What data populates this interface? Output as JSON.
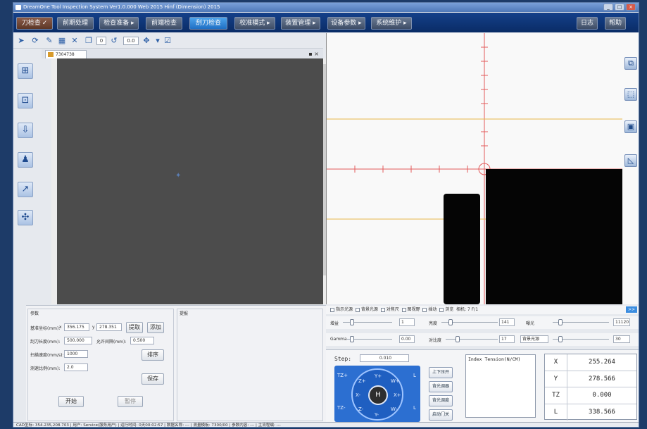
{
  "window": {
    "title": "DreamOne Tool Inspection System Ver1.0.000 Web 2015 Hinf (Dimension) 2015"
  },
  "menu": {
    "first": "刀检查",
    "items": [
      "前期处理",
      "检查准备 ▸",
      "前端检查",
      "刮刀检查",
      "校准模式 ▸",
      "装置管理 ▸",
      "设备参数 ▸",
      "系统维护 ▸"
    ],
    "right": [
      "日志",
      "帮助"
    ]
  },
  "toolbar": {
    "field1": "0",
    "field2": "0.0"
  },
  "doc": {
    "tab": "7304738"
  },
  "camera_panel": {
    "checkboxes": [
      "指示光源",
      "背景光源",
      "对焦尺",
      "图视野",
      "插动",
      "浏览"
    ],
    "status": "相机: 7 F/1",
    "expand_label": ">>",
    "row1": {
      "l1": "增益",
      "v1": "1",
      "l2": "亮度",
      "v2": "141",
      "l3": "曝光",
      "v3": "11120"
    },
    "row2": {
      "l1": "Gamma",
      "v1": "0.00",
      "l2": "对比度",
      "v2": "17",
      "select": "背景光源",
      "v3": "30"
    }
  },
  "params": {
    "title": "参数",
    "notes_title": "提报",
    "center_label": "基准坐标(mm):",
    "x_label": "x",
    "x_value": "356.175",
    "y_label": "y",
    "y_value": "278.351",
    "extract_button": "提取",
    "add_button": "添加",
    "tool_length_label": "刮刀长度(mm):",
    "tool_length": "500.000",
    "spacing_label": "允许间隔(mm):",
    "spacing": "0.500",
    "speed_label": "扫描速度(mm/s):",
    "speed": "1000",
    "sort_button": "排序",
    "ratio_label": "测速比例(mm):",
    "ratio": "2.0",
    "save_button": "保存",
    "start_button": "开始",
    "pause_button": "暂停"
  },
  "motion": {
    "step_label": "Step:",
    "step_value": "0.010",
    "dpad": {
      "center": "H",
      "z_plus": "Z+",
      "z_minus": "Z-",
      "y_plus": "Y+",
      "y_minus": "Y-",
      "x_plus": "X+",
      "x_minus": "X-",
      "w_plus": "W+",
      "w_minus": "W-",
      "tz_plus": "TZ+",
      "tz_minus": "TZ-",
      "l1": "L",
      "l2": "L"
    },
    "side_buttons": [
      "上下压开",
      "背光调器",
      "背光调度",
      "启动门关"
    ],
    "tension_header": "Index  Tension(N/CM)",
    "coords": [
      {
        "k": "X",
        "v": "255.264"
      },
      {
        "k": "Y",
        "v": "278.566"
      },
      {
        "k": "TZ",
        "v": "0.000"
      },
      {
        "k": "L",
        "v": "338.566"
      }
    ]
  },
  "statusbar": "CAD坐标: 354.235,208.703 | 用户: Service(服务用户) | 运行时间: 0天00:02:57 | 数据名称: --- | 测量模板: 7300/00 | 参数内容: --- | 主流程编: ---"
}
